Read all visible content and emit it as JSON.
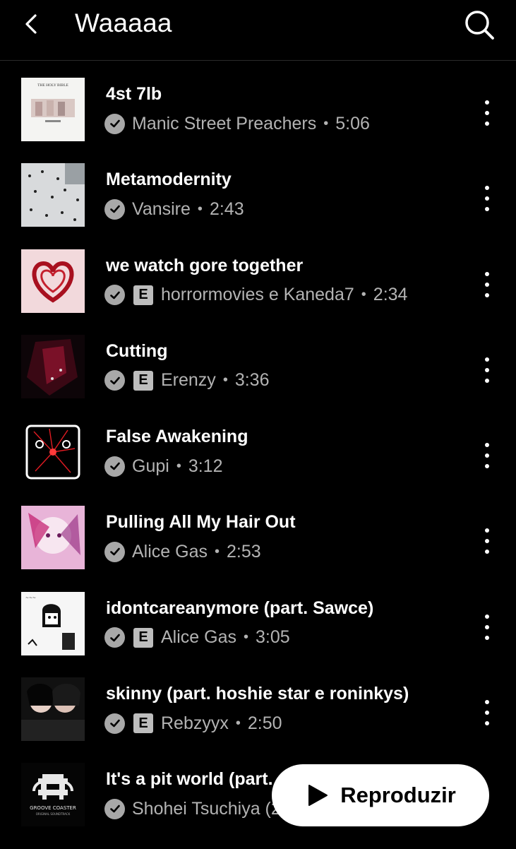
{
  "header": {
    "title": "Waaaaa",
    "back_icon": "chevron-left-icon",
    "search_icon": "search-icon"
  },
  "tracks": [
    {
      "title": "4st 7lb",
      "artist": "Manic Street Preachers",
      "duration": "5:06",
      "explicit": false,
      "art": "cover-holy-bible"
    },
    {
      "title": "Metamodernity",
      "artist": "Vansire",
      "duration": "2:43",
      "explicit": false,
      "art": "cover-crowd"
    },
    {
      "title": "we watch gore together",
      "artist": "horrormovies e Kaneda7",
      "duration": "2:34",
      "explicit": true,
      "art": "cover-heart"
    },
    {
      "title": "Cutting",
      "artist": "Erenzy",
      "duration": "3:36",
      "explicit": true,
      "art": "cover-dark-red"
    },
    {
      "title": "False Awakening",
      "artist": "Gupi",
      "duration": "3:12",
      "explicit": false,
      "art": "cover-red-lines"
    },
    {
      "title": "Pulling All My Hair Out",
      "artist": "Alice Gas",
      "duration": "2:53",
      "explicit": false,
      "art": "cover-pink-anime"
    },
    {
      "title": "idontcareanymore (part. Sawce)",
      "artist": "Alice Gas",
      "duration": "3:05",
      "explicit": true,
      "art": "cover-sketch"
    },
    {
      "title": "skinny (part. hoshie star e roninkys)",
      "artist": "Rebzyyx",
      "duration": "2:50",
      "explicit": true,
      "art": "cover-photo-duo"
    },
    {
      "title": "It's a pit world (part.",
      "artist": "Shohei Tsuchiya (2",
      "duration": "",
      "explicit": false,
      "art": "cover-groove-coaster"
    }
  ],
  "labels": {
    "explicit_badge": "E",
    "separator": "•"
  },
  "album_text": {
    "holy_bible": "THE HOLY BIBLE",
    "groove_coaster": "GROOVE COASTER",
    "groove_sub": "ORIGINAL SOUNDTRACK"
  },
  "play_button": {
    "label": "Reproduzir",
    "icon": "play-icon"
  },
  "colors": {
    "background": "#000000",
    "secondary_text": "#b3b3b3",
    "check_badge": "#a8a8a8",
    "button_bg": "#ffffff"
  }
}
